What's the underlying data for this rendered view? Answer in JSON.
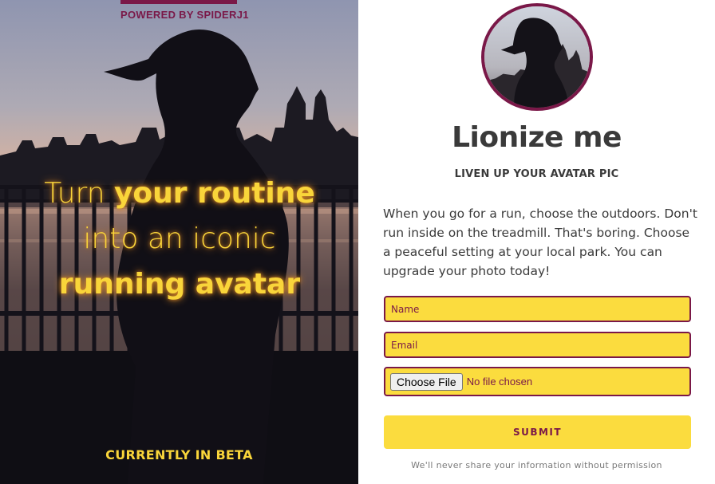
{
  "hero": {
    "powered_by": "POWERED BY SPIDERJ1",
    "headline": {
      "line1_light": "Turn ",
      "line1_bold": "your routine",
      "line2": "into an iconic",
      "line3": "running avatar"
    },
    "beta_label": "CURRENTLY IN BETA",
    "image": "runner-silhouette-city-skyline-photo"
  },
  "panel": {
    "avatar_image": "runner-avatar-photo",
    "title": "Lionize me",
    "subtitle": "LIVEN UP YOUR AVATAR PIC",
    "description": "When you go for a run, choose the outdoors. Don't run inside on the treadmill. That's boring. Choose a peaceful setting at your local park. You can upgrade your photo today!"
  },
  "form": {
    "name_placeholder": "Name",
    "email_placeholder": "Email",
    "file_button_label": "Choose File",
    "file_status": "No file chosen",
    "submit_label": "SUBMIT",
    "privacy_note": "We'll never share your information without permission"
  },
  "colors": {
    "accent": "#7a1848",
    "highlight": "#fbdc3e",
    "headline_text": "#f9d53a",
    "body_text": "#3a3a3a"
  }
}
